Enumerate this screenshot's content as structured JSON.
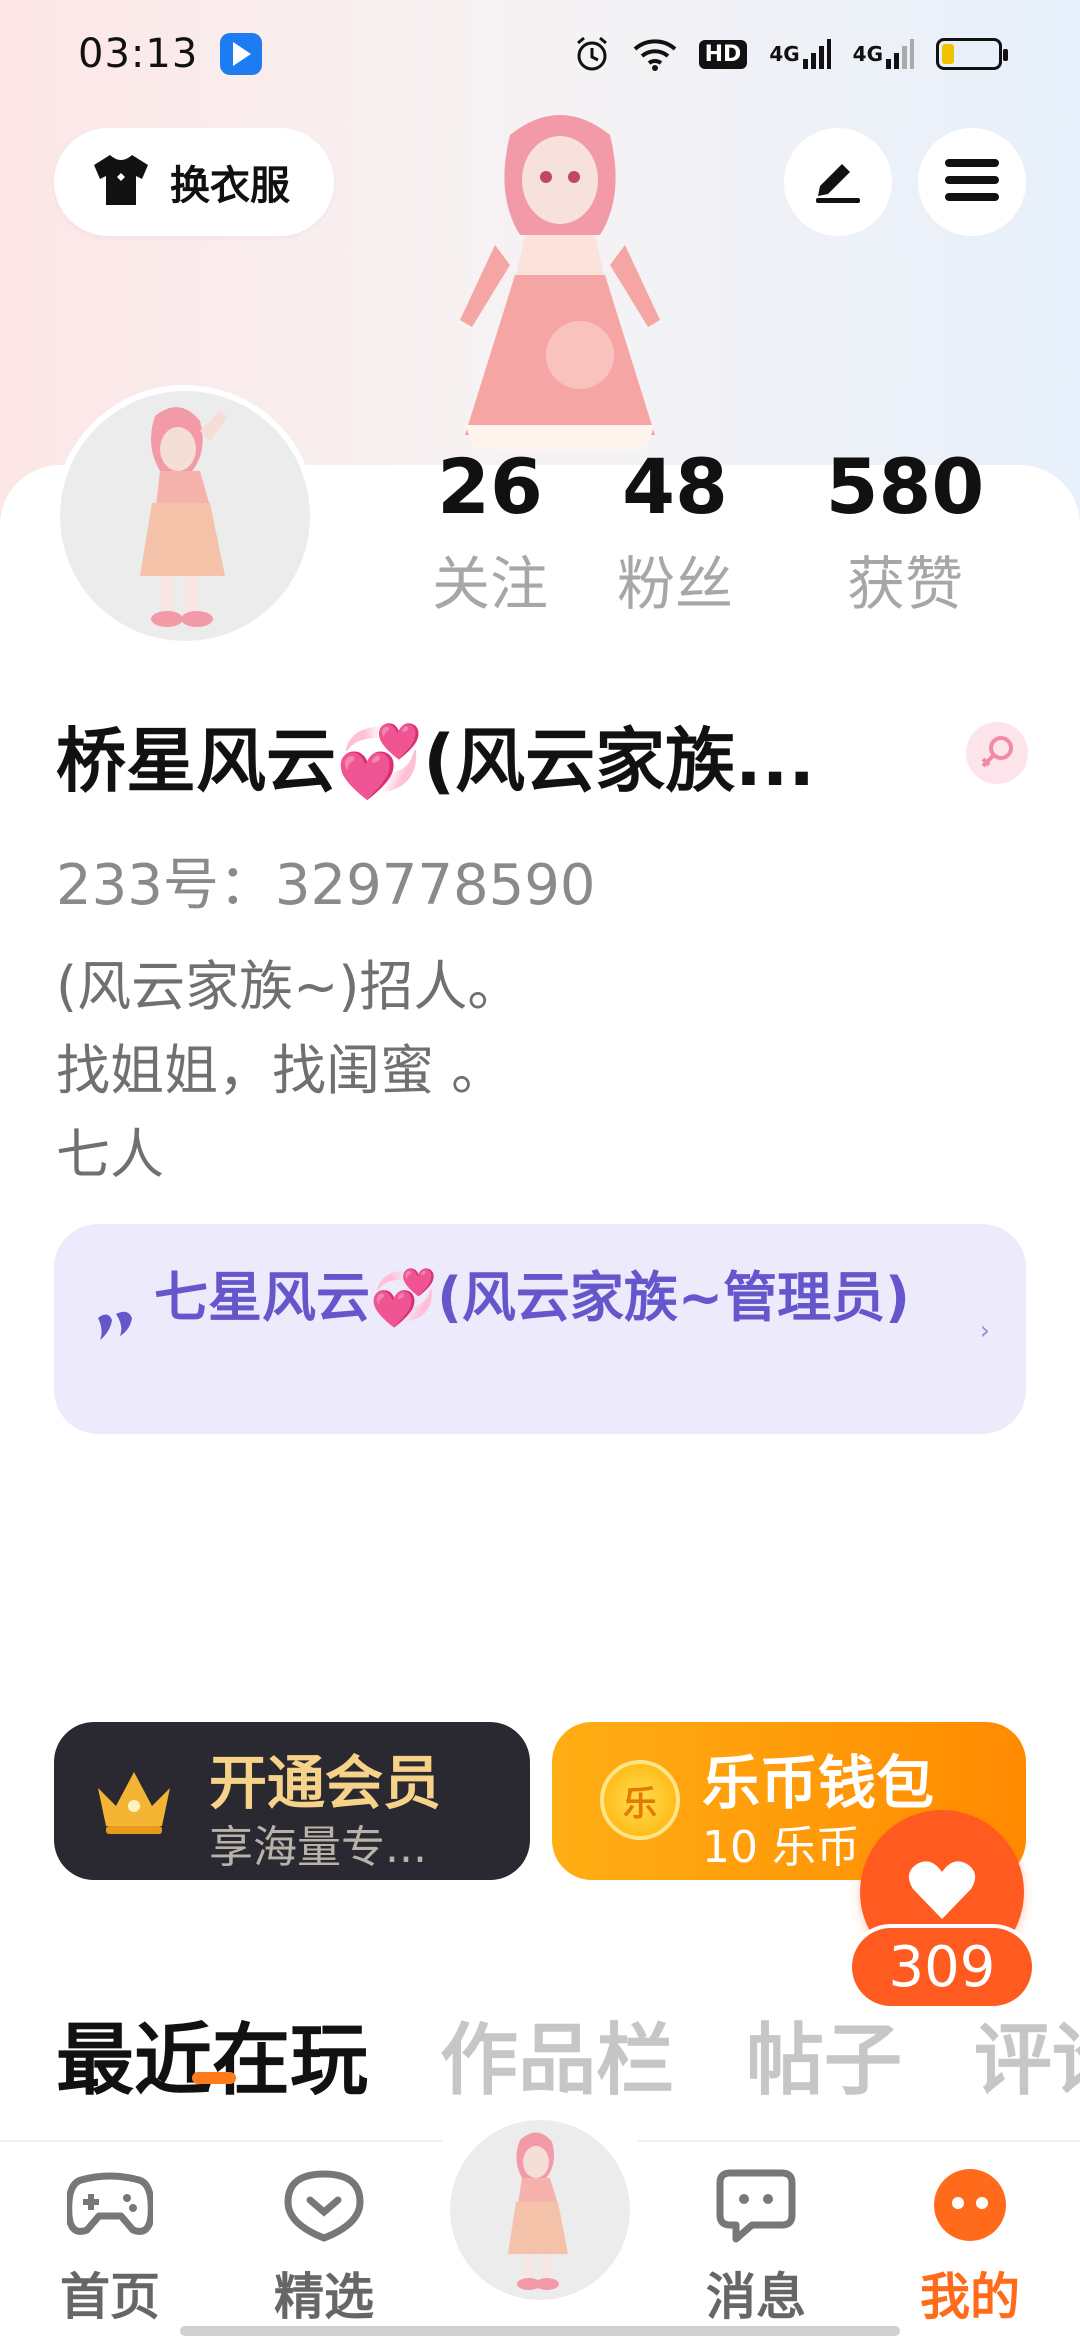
{
  "status_bar": {
    "time": "03:13",
    "hd_label": "HD",
    "signal1": "4G",
    "signal2": "4G"
  },
  "header": {
    "dress_label": "换衣服"
  },
  "profile": {
    "stats": [
      {
        "value": "26",
        "label": "关注"
      },
      {
        "value": "48",
        "label": "粉丝"
      },
      {
        "value": "580",
        "label": "获赞"
      }
    ],
    "username": "桥星风云💞(风云家族...",
    "id_line": "233号：329778590",
    "bio_lines": [
      "(风云家族~)招人。",
      "找姐姐，找闺蜜 。",
      "七人"
    ],
    "gender": "female"
  },
  "family": {
    "text": "七星风云💞(风云家族~管理员)"
  },
  "vip": {
    "title": "开通会员",
    "subtitle": "享海量专..."
  },
  "wallet": {
    "title": "乐币钱包",
    "subtitle": "10 乐币",
    "coin_glyph": "乐"
  },
  "like": {
    "count": "309"
  },
  "tabs": [
    {
      "label": "最近在玩",
      "active": true
    },
    {
      "label": "作品栏",
      "active": false
    },
    {
      "label": "帖子",
      "active": false
    },
    {
      "label": "评论",
      "active": false
    }
  ],
  "bottom_nav": [
    {
      "label": "首页",
      "icon": "gamepad-icon"
    },
    {
      "label": "精选",
      "icon": "heart-chat-icon"
    },
    {
      "label": "消息",
      "icon": "message-icon"
    },
    {
      "label": "我的",
      "icon": "me-icon",
      "active": true
    }
  ],
  "colors": {
    "accent": "#ff6b1a",
    "family_text": "#6656cc",
    "vip_bg": "#2a2830",
    "vip_gold": "#f6d389"
  }
}
